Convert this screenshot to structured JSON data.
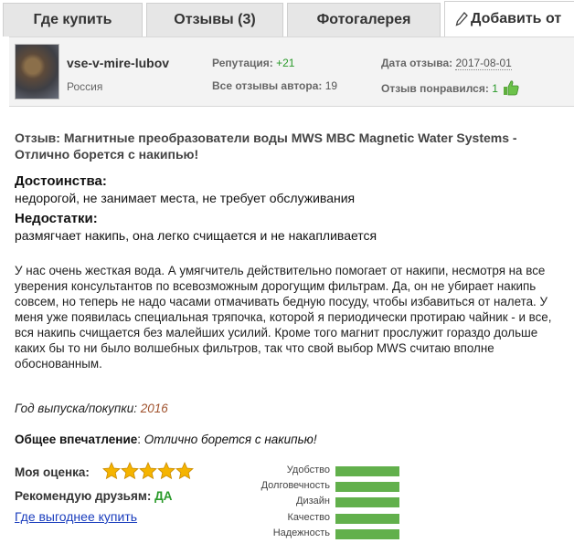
{
  "tabs": {
    "buy": "Где купить",
    "reviews": "Отзывы (3)",
    "gallery": "Фотогалерея",
    "add": "Добавить от"
  },
  "author": {
    "name": "vse-v-mire-lubov",
    "country": "Россия",
    "reputation_label": "Репутация:",
    "reputation_value": "+21",
    "all_reviews_label": "Все отзывы автора:",
    "all_reviews_value": "19",
    "date_label": "Дата отзыва:",
    "date_value": "2017-08-01",
    "liked_label": "Отзыв понравился:",
    "liked_value": "1"
  },
  "review": {
    "title": "Отзыв: Магнитные преобразователи воды MWS MBC Magnetic Water Systems - Отлично борется с накипью!",
    "pros_label": "Достоинства:",
    "pros_text": "недорогой, не занимает места, не требует обслуживания",
    "cons_label": "Недостатки:",
    "cons_text": "размягчает накипь, она легко счищается и не накапливается",
    "body": "У нас очень жесткая вода. А умягчитель действительно помогает от накипи, несмотря на все уверения консультантов по всевозможным дорогущим фильтрам. Да, он не убирает накипь совсем, но теперь не надо часами отмачивать бедную посуду, чтобы избавиться от налета. У меня уже появилась специальная тряпочка, которой я периодически протираю чайник - и все, вся накипь счищается без малейших усилий. Кроме того магнит прослужит гораздо дольше каких бы то ни было волшебных фильтров, так что свой выбор MWS считаю вполне обоснованным.",
    "year_label": "Год выпуска/покупки:",
    "year_value": "2016",
    "overall_label": "Общее впечатление",
    "overall_value": "Отлично борется с накипью!",
    "my_rating_label": "Моя оценка:",
    "my_rating_stars": 5,
    "recommend_label": "Рекомендую друзьям:",
    "recommend_value": "ДА",
    "where_cheaper": "Где выгоднее купить"
  },
  "metrics": [
    {
      "label": "Удобство",
      "fill": 1.0
    },
    {
      "label": "Долговечность",
      "fill": 1.0
    },
    {
      "label": "Дизайн",
      "fill": 1.0
    },
    {
      "label": "Качество",
      "fill": 1.0
    },
    {
      "label": "Надежность",
      "fill": 1.0
    }
  ],
  "colors": {
    "accent_green": "#62b04c",
    "star": "#f5b400",
    "link": "#1a3dbd"
  }
}
